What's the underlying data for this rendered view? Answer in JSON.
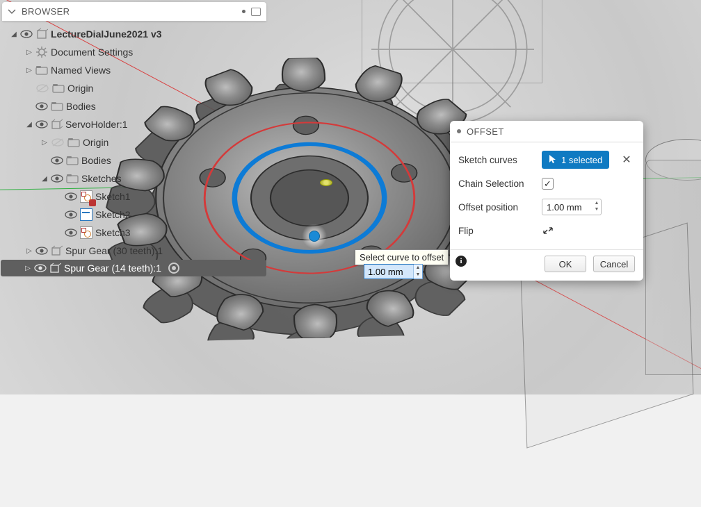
{
  "browser": {
    "title": "BROWSER",
    "root": "LectureDialJune2021 v3",
    "docSettings": "Document Settings",
    "namedViews": "Named Views",
    "origin": "Origin",
    "bodies": "Bodies",
    "servo": "ServoHolder:1",
    "servoOrigin": "Origin",
    "servoBodies": "Bodies",
    "sketches": "Sketches",
    "sketch1": "Sketch1",
    "sketch2": "Sketch2",
    "sketch3": "Sketch3",
    "spur30": "Spur Gear (30 teeth):1",
    "spur14": "Spur Gear (14 teeth):1"
  },
  "offset": {
    "title": "OFFSET",
    "curvesLabel": "Sketch curves",
    "selected": "1 selected",
    "chainLabel": "Chain Selection",
    "chainChecked": "✓",
    "posLabel": "Offset position",
    "posValue": "1.00 mm",
    "flipLabel": "Flip",
    "ok": "OK",
    "cancel": "Cancel"
  },
  "tooltip": "Select curve to offset",
  "floatingValue": "1.00 mm"
}
